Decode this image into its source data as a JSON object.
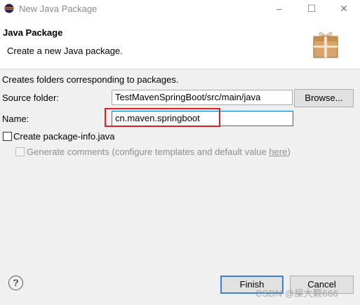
{
  "window": {
    "title": "New Java Package",
    "minimize_glyph": "–",
    "maximize_glyph": "☐",
    "close_glyph": "✕"
  },
  "header": {
    "title": "Java Package",
    "description": "Create a new Java package."
  },
  "form": {
    "intro": "Creates folders corresponding to packages.",
    "source_folder_label": "Source folder:",
    "source_folder_value": "TestMavenSpringBoot/src/main/java",
    "browse_label": "Browse...",
    "name_label": "Name:",
    "name_value": "cn.maven.springboot",
    "create_package_info_label": "Create package-info.java",
    "create_package_info_checked": false,
    "generate_comments_label": "Generate comments (configure templates and default value ",
    "generate_comments_link": "here",
    "generate_comments_suffix": ")",
    "generate_comments_checked": false
  },
  "footer": {
    "help_glyph": "?",
    "finish_label": "Finish",
    "cancel_label": "Cancel"
  },
  "watermark": "CSDN @屎大颗666",
  "icons": {
    "app": "eclipse-icon",
    "banner": "package-wizard-banner-icon",
    "help": "help-icon"
  },
  "colors": {
    "highlight_box": "#e02020",
    "default_button_border": "#3b7fd6"
  }
}
